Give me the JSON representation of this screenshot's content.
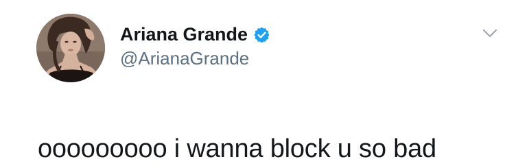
{
  "tweet": {
    "author": {
      "display_name": "Ariana Grande",
      "handle": "@ArianaGrande",
      "verified": true,
      "avatar_icon": "profile-photo"
    },
    "menu_icon": "chevron-down-icon",
    "text": "ooooooooo i wanna block u so bad"
  },
  "colors": {
    "text_primary": "#14171a",
    "text_secondary": "#5b7083",
    "verified_badge": "#1da1f2",
    "background": "#ffffff"
  }
}
